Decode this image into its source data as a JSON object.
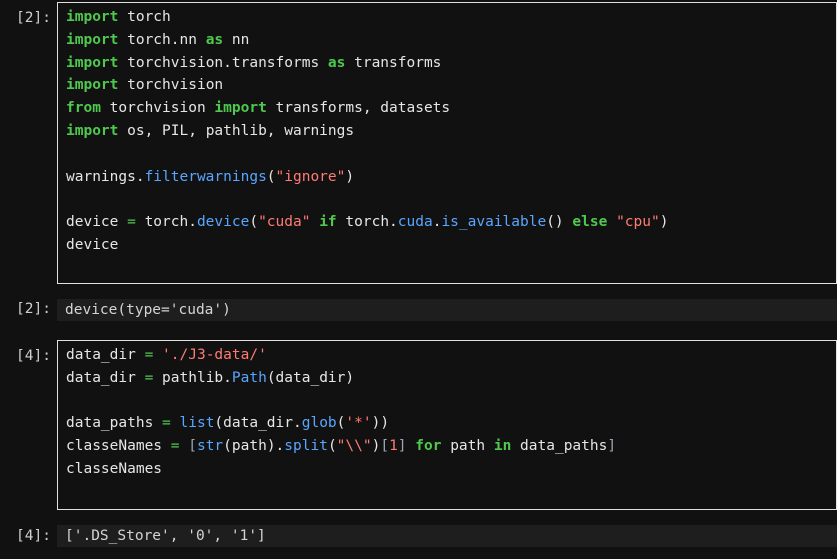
{
  "cells": [
    {
      "prompt": "[2]:",
      "lines": [
        [
          [
            "kw",
            "import"
          ],
          [
            "plain",
            " torch"
          ]
        ],
        [
          [
            "kw",
            "import"
          ],
          [
            "plain",
            " torch.nn "
          ],
          [
            "kw",
            "as"
          ],
          [
            "plain",
            " nn"
          ]
        ],
        [
          [
            "kw",
            "import"
          ],
          [
            "plain",
            " torchvision.transforms "
          ],
          [
            "kw",
            "as"
          ],
          [
            "plain",
            " transforms"
          ]
        ],
        [
          [
            "kw",
            "import"
          ],
          [
            "plain",
            " torchvision"
          ]
        ],
        [
          [
            "kw",
            "from"
          ],
          [
            "plain",
            " torchvision "
          ],
          [
            "kw",
            "import"
          ],
          [
            "plain",
            " transforms, datasets"
          ]
        ],
        [
          [
            "kw",
            "import"
          ],
          [
            "plain",
            " os, PIL, pathlib, warnings"
          ]
        ],
        [],
        [
          [
            "plain",
            "warnings."
          ],
          [
            "fn",
            "filterwarnings"
          ],
          [
            "plain",
            "("
          ],
          [
            "str",
            "\"ignore\""
          ],
          [
            "plain",
            ")"
          ]
        ],
        [],
        [
          [
            "plain",
            "device "
          ],
          [
            "kw2",
            "="
          ],
          [
            "plain",
            " torch."
          ],
          [
            "fn",
            "device"
          ],
          [
            "plain",
            "("
          ],
          [
            "str",
            "\"cuda\""
          ],
          [
            "plain",
            " "
          ],
          [
            "kw",
            "if"
          ],
          [
            "plain",
            " torch."
          ],
          [
            "fn",
            "cuda"
          ],
          [
            "plain",
            "."
          ],
          [
            "fn",
            "is_available"
          ],
          [
            "plain",
            "() "
          ],
          [
            "kw",
            "else"
          ],
          [
            "plain",
            " "
          ],
          [
            "str",
            "\"cpu\""
          ],
          [
            "plain",
            ")"
          ]
        ],
        [
          [
            "plain",
            "device"
          ]
        ]
      ]
    },
    {
      "prompt": "[2]:",
      "output": "device(type='cuda')"
    },
    {
      "prompt": "[4]:",
      "lines": [
        [
          [
            "plain",
            "data_dir "
          ],
          [
            "kw2",
            "="
          ],
          [
            "plain",
            " "
          ],
          [
            "str",
            "'./J3-data/'"
          ]
        ],
        [
          [
            "plain",
            "data_dir "
          ],
          [
            "kw2",
            "="
          ],
          [
            "plain",
            " pathlib."
          ],
          [
            "fn",
            "Path"
          ],
          [
            "plain",
            "(data_dir)"
          ]
        ],
        [],
        [
          [
            "plain",
            "data_paths "
          ],
          [
            "kw2",
            "="
          ],
          [
            "plain",
            " "
          ],
          [
            "fn",
            "list"
          ],
          [
            "plain",
            "(data_dir."
          ],
          [
            "fn",
            "glob"
          ],
          [
            "plain",
            "("
          ],
          [
            "str",
            "'*'"
          ],
          [
            "plain",
            "))"
          ]
        ],
        [
          [
            "plain",
            "classeNames "
          ],
          [
            "kw2",
            "="
          ],
          [
            "plain",
            " "
          ],
          [
            "br",
            "["
          ],
          [
            "fn",
            "str"
          ],
          [
            "plain",
            "(path)."
          ],
          [
            "fn",
            "split"
          ],
          [
            "plain",
            "("
          ],
          [
            "str",
            "\"\\\\\""
          ],
          [
            "plain",
            ")"
          ],
          [
            "br",
            "["
          ],
          [
            "num",
            "1"
          ],
          [
            "br",
            "]"
          ],
          [
            "plain",
            " "
          ],
          [
            "kw",
            "for"
          ],
          [
            "plain",
            " path "
          ],
          [
            "kw",
            "in"
          ],
          [
            "plain",
            " data_paths"
          ],
          [
            "br",
            "]"
          ]
        ],
        [
          [
            "plain",
            "classeNames"
          ]
        ]
      ]
    },
    {
      "prompt": "[4]:",
      "output": "['.DS_Store', '0', '1']"
    }
  ]
}
